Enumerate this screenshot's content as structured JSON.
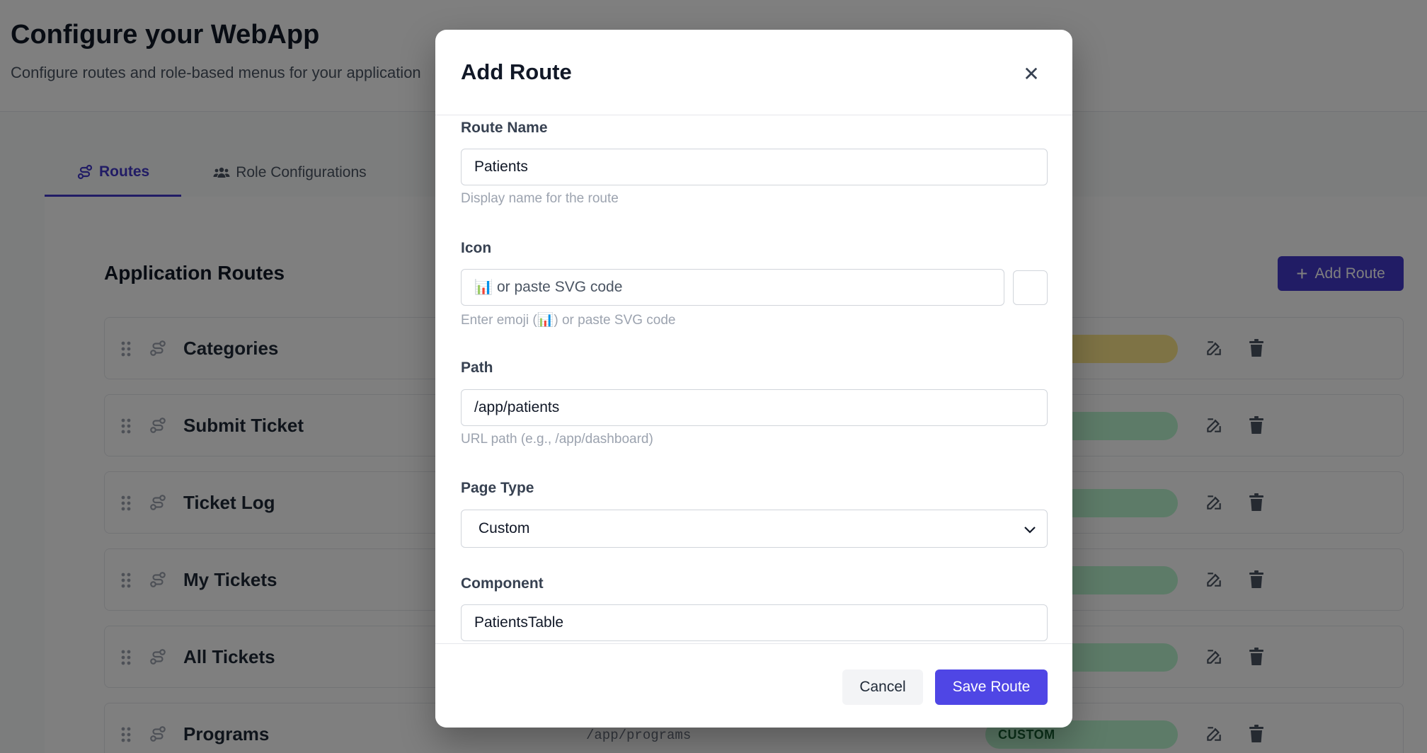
{
  "page": {
    "title": "Configure your WebApp",
    "subtitle": "Configure routes and role-based menus for your application"
  },
  "tabs": [
    {
      "label": "Routes",
      "icon": "route-icon",
      "active": true
    },
    {
      "label": "Role Configurations",
      "icon": "users-icon",
      "active": false
    }
  ],
  "routes_section": {
    "title": "Application Routes",
    "add_button_label": "Add Route",
    "rows": [
      {
        "name": "Categories",
        "badge_color": "#fde68a"
      },
      {
        "name": "Submit Ticket",
        "badge_color": "#bbf7d0"
      },
      {
        "name": "Ticket Log",
        "badge_color": "#bbf7d0"
      },
      {
        "name": "My Tickets",
        "badge_color": "#bbf7d0"
      },
      {
        "name": "All Tickets",
        "badge_color": "#bbf7d0"
      },
      {
        "name": "Programs",
        "path": "/app/programs",
        "badge": "CUSTOM",
        "badge_color": "#bbf7d0"
      }
    ]
  },
  "modal": {
    "title": "Add Route",
    "close_icon": "close-icon",
    "route_name": {
      "label": "Route Name",
      "value": "Patients",
      "help": "Display name for the route"
    },
    "icon_field": {
      "label": "Icon",
      "value": "",
      "placeholder": "📊 or paste SVG code",
      "help": "Enter emoji (📊) or paste SVG code"
    },
    "path": {
      "label": "Path",
      "value": "/app/patients",
      "help": "URL path (e.g., /app/dashboard)"
    },
    "page_type": {
      "label": "Page Type",
      "selected": "Custom"
    },
    "component": {
      "label": "Component",
      "value": "PatientsTable"
    },
    "cancel_label": "Cancel",
    "save_label": "Save Route"
  },
  "colors": {
    "primary": "#4338ca",
    "save_button": "#4f46e5",
    "overlay": "rgba(0,0,0,0.5)"
  }
}
